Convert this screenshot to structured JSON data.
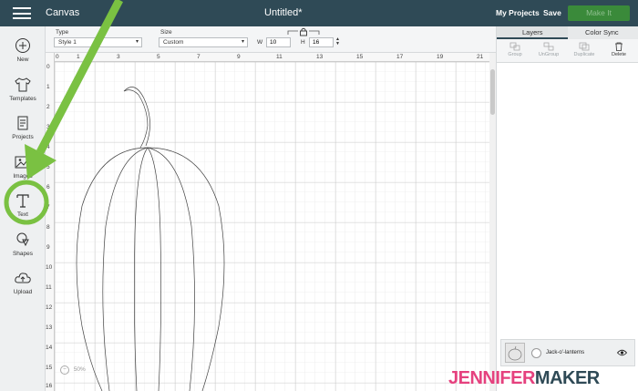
{
  "topbar": {
    "app_title": "Canvas",
    "doc_title": "Untitled*",
    "my_projects": "My Projects",
    "save": "Save",
    "make_it": "Make It"
  },
  "sidebar": {
    "items": [
      {
        "label": "New",
        "icon": "plus-circle-icon"
      },
      {
        "label": "Templates",
        "icon": "shirt-icon"
      },
      {
        "label": "Projects",
        "icon": "projects-icon"
      },
      {
        "label": "Images",
        "icon": "image-icon"
      },
      {
        "label": "Text",
        "icon": "text-icon"
      },
      {
        "label": "Shapes",
        "icon": "shapes-icon"
      },
      {
        "label": "Upload",
        "icon": "upload-icon"
      }
    ]
  },
  "options": {
    "type_label": "Type",
    "type_value": "Style 1",
    "size_label": "Size",
    "size_value": "Custom",
    "w_label": "W",
    "w_value": "10",
    "h_label": "H",
    "h_value": "16"
  },
  "ruler": {
    "top": [
      "0",
      "1",
      "3",
      "5",
      "7",
      "9",
      "11",
      "13",
      "15",
      "17",
      "19",
      "21"
    ],
    "left": [
      "0",
      "1",
      "2",
      "3",
      "4",
      "5",
      "6",
      "7",
      "8",
      "9",
      "10",
      "11",
      "12",
      "13",
      "14",
      "15",
      "16"
    ]
  },
  "zoom": {
    "value": "50%"
  },
  "panel": {
    "tabs": [
      "Layers",
      "Color Sync"
    ],
    "tools": [
      "Group",
      "UnGroup",
      "Duplicate",
      "Delete"
    ],
    "layer": {
      "name": "Jack-o'-lanterns"
    }
  },
  "watermark": {
    "part1": "JENNIFER",
    "part2": "MAKER"
  },
  "colors": {
    "topbar": "#2f4a56",
    "annotation_green": "#7ac142",
    "make_button": "#3a8a3a"
  }
}
